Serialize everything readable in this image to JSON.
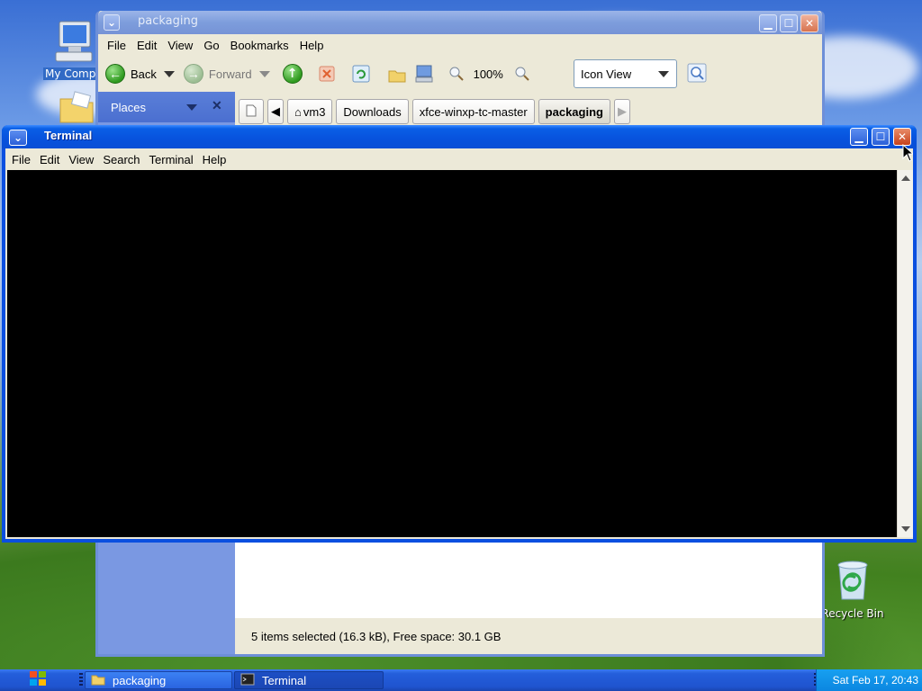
{
  "desktop": {
    "icons": [
      {
        "label": "My Computer",
        "visible_label": "My Compu",
        "icon": "computer-icon"
      },
      {
        "label": "Recycle Bin",
        "icon": "recycle-bin-icon"
      }
    ]
  },
  "file_manager": {
    "title": "packaging",
    "menu": [
      "File",
      "Edit",
      "View",
      "Go",
      "Bookmarks",
      "Help"
    ],
    "toolbar": {
      "back_label": "Back",
      "forward_label": "Forward",
      "zoom_level": "100%",
      "view_mode": "Icon View"
    },
    "sidebar_title": "Places",
    "path": [
      "vm3",
      "Downloads",
      "xfce-winxp-tc-master",
      "packaging"
    ],
    "status": "5 items selected (16.3 kB), Free space: 30.1 GB"
  },
  "terminal": {
    "title": "Terminal",
    "menu": [
      "File",
      "Edit",
      "View",
      "Search",
      "Terminal",
      "Help"
    ]
  },
  "taskbar": {
    "tasks": [
      {
        "label": "packaging",
        "icon": "folder-icon",
        "active": true
      },
      {
        "label": "Terminal",
        "icon": "terminal-icon",
        "active": false
      }
    ],
    "clock": "Sat Feb 17, 20:43"
  },
  "colors": {
    "terminal_title": "#0752dd",
    "taskbar": "#245edb",
    "terminal_bg": "#000000"
  }
}
